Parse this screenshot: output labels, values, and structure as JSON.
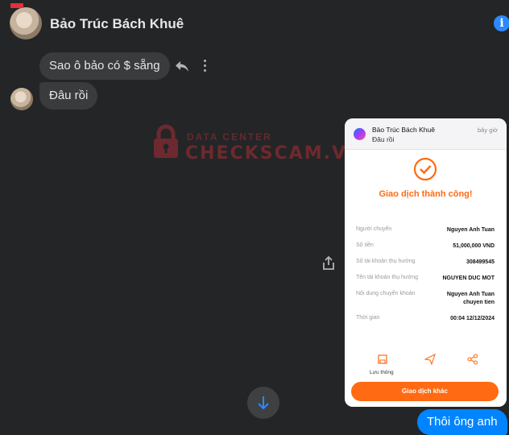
{
  "header": {
    "contact_name": "Bảo Trúc Bách Khuê",
    "info_icon": "info-icon"
  },
  "conversation": {
    "incoming": [
      {
        "text": "Sao ô bảo có $ sẵng"
      },
      {
        "text": "Đâu rồi"
      }
    ],
    "outgoing": [
      {
        "text": "Thôi ông anh"
      }
    ],
    "actions": {
      "reply_icon": "reply-icon",
      "more_icon": "more-vertical-icon",
      "share_icon": "share-icon",
      "scroll_icon": "arrow-down-icon"
    }
  },
  "watermark": {
    "small": "DATA CENTER",
    "big": "CHECKSCAM.VN"
  },
  "attachment": {
    "notification": {
      "sender": "Bảo Trúc Bách Khuê",
      "message": "Đâu rồi",
      "time": "bây giờ"
    },
    "success_title": "Giao dịch thành công!",
    "rows": [
      {
        "label": "Người chuyển",
        "value": "Nguyen Anh Tuan"
      },
      {
        "label": "Số tiền",
        "value": "51,000,000 VND"
      },
      {
        "label": "Số tài khoản thụ hưởng",
        "value": "308499545"
      },
      {
        "label": "Tên tài khoản thụ hưởng",
        "value": "NGUYEN DUC MOT"
      },
      {
        "label": "Nội dung chuyển khoản",
        "value": "Nguyen Anh Tuan\nchuyen tien"
      },
      {
        "label": "Thời gian",
        "value": "00:04 12/12/2024"
      }
    ],
    "bottom_actions": [
      {
        "label": "Lưu thông",
        "icon": "save-icon"
      },
      {
        "label": "",
        "icon": "send-icon"
      },
      {
        "label": "",
        "icon": "share-nodes-icon"
      }
    ],
    "cta_label": "Giao dịch khác",
    "accent_color": "#ff6a13"
  },
  "colors": {
    "background": "#242526",
    "incoming_bubble": "#3a3b3c",
    "outgoing_bubble": "#0084ff"
  }
}
